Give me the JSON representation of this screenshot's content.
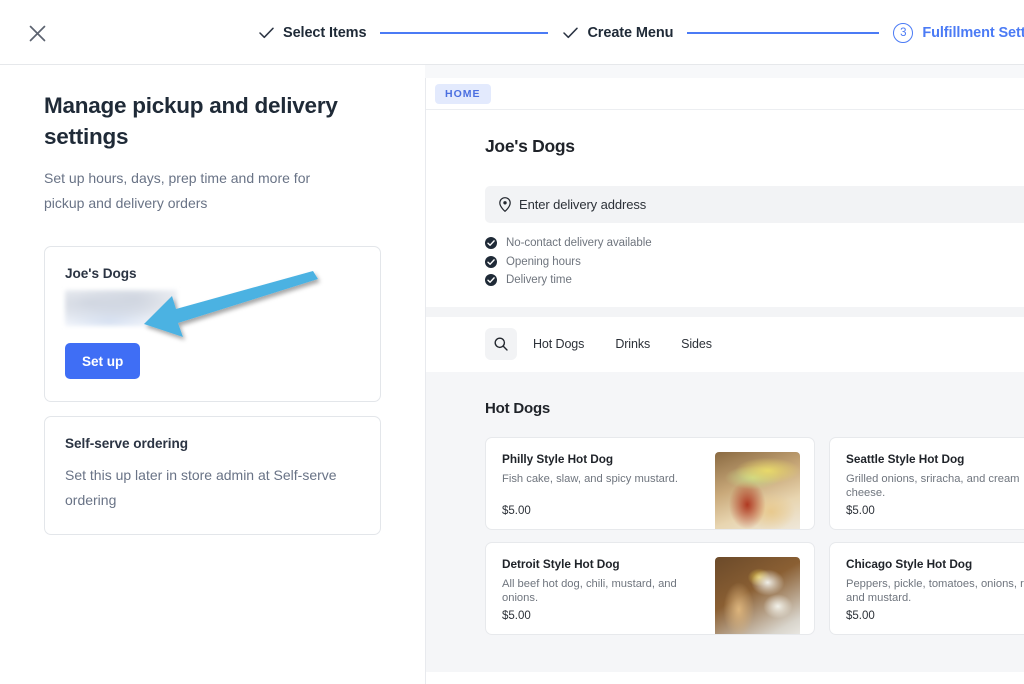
{
  "header": {
    "close_icon": "close-icon",
    "steps": [
      {
        "label": "Select Items",
        "state": "complete",
        "icon": "check-icon"
      },
      {
        "label": "Create Menu",
        "state": "complete",
        "icon": "check-icon"
      },
      {
        "label": "Fulfillment Settings",
        "state": "current",
        "number": "3"
      }
    ]
  },
  "left": {
    "title": "Manage pickup and delivery settings",
    "subtitle": "Set up hours, days, prep time and more for pickup and delivery orders",
    "store_card": {
      "title": "Joe's Dogs",
      "redacted_value": "",
      "button_label": "Set up"
    },
    "selfserve_card": {
      "title": "Self-serve ordering",
      "description": "Set this up later in store admin at Self-serve ordering"
    },
    "annotation": {
      "type": "arrow",
      "color": "#4cb2e2",
      "points_to": "Set up"
    }
  },
  "preview": {
    "tab_chip": "HOME",
    "store_name": "Joe's Dogs",
    "address_bar": {
      "icon": "location-pin-icon",
      "placeholder": "Enter delivery address"
    },
    "features": [
      {
        "icon": "check-circle-icon",
        "label": "No-contact delivery available"
      },
      {
        "icon": "check-circle-icon",
        "label": "Opening hours"
      },
      {
        "icon": "check-circle-icon",
        "label": "Delivery time"
      }
    ],
    "search": {
      "icon": "search-icon"
    },
    "categories": [
      "Hot Dogs",
      "Drinks",
      "Sides"
    ],
    "menu_heading": "Hot Dogs",
    "items": [
      {
        "name": "Philly Style Hot Dog",
        "description": "Fish cake, slaw, and spicy mustard.",
        "price": "$5.00",
        "thumb": "philly"
      },
      {
        "name": "Seattle Style Hot Dog",
        "description": "Grilled onions, sriracha, and cream cheese.",
        "price": "$5.00",
        "thumb": ""
      },
      {
        "name": "Detroit Style Hot Dog",
        "description": "All beef hot dog, chili, mustard, and onions.",
        "price": "$5.00",
        "thumb": "detroit"
      },
      {
        "name": "Chicago Style Hot Dog",
        "description": "Peppers, pickle, tomatoes, onions, relish, and mustard.",
        "price": "$5.00",
        "thumb": ""
      }
    ]
  },
  "colors": {
    "accent_blue": "#4b7bf5",
    "button_blue": "#3f6ef5",
    "chip_bg": "#e3eafd",
    "chip_text": "#4b6fe0",
    "arrow_blue": "#4cb2e2",
    "page_bg": "#f7f8fa",
    "text_primary": "#1f2a37",
    "text_muted": "#697386"
  }
}
